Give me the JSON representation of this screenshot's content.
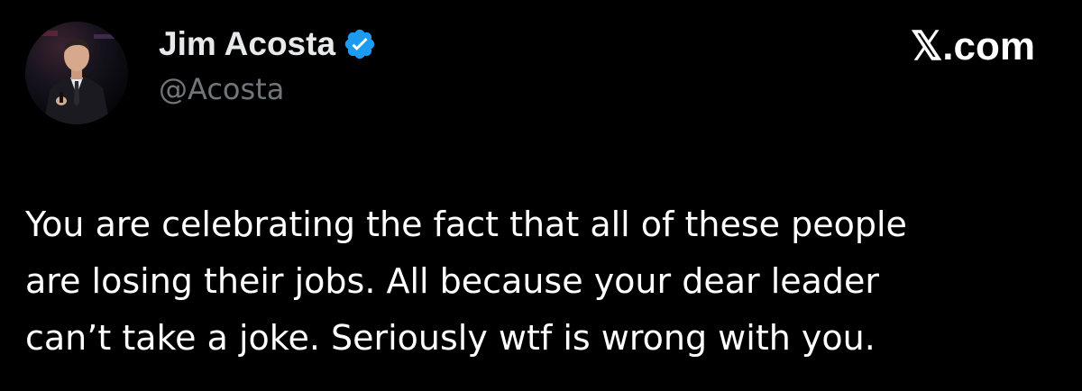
{
  "author": {
    "name": "Jim Acosta",
    "handle": "@Acosta",
    "verified": true,
    "avatar_icon": "profile-photo-avatar"
  },
  "brand": {
    "label": "𝕏.com"
  },
  "tweet": {
    "lines": [
      "You are celebrating the fact that all of these people",
      "are losing their jobs. All because your dear leader",
      "can’t take a joke. Seriously wtf is wrong with you."
    ]
  },
  "colors": {
    "background": "#000000",
    "text": "#ffffff",
    "handle": "#71767b",
    "verified_badge": "#1d9bf0"
  }
}
